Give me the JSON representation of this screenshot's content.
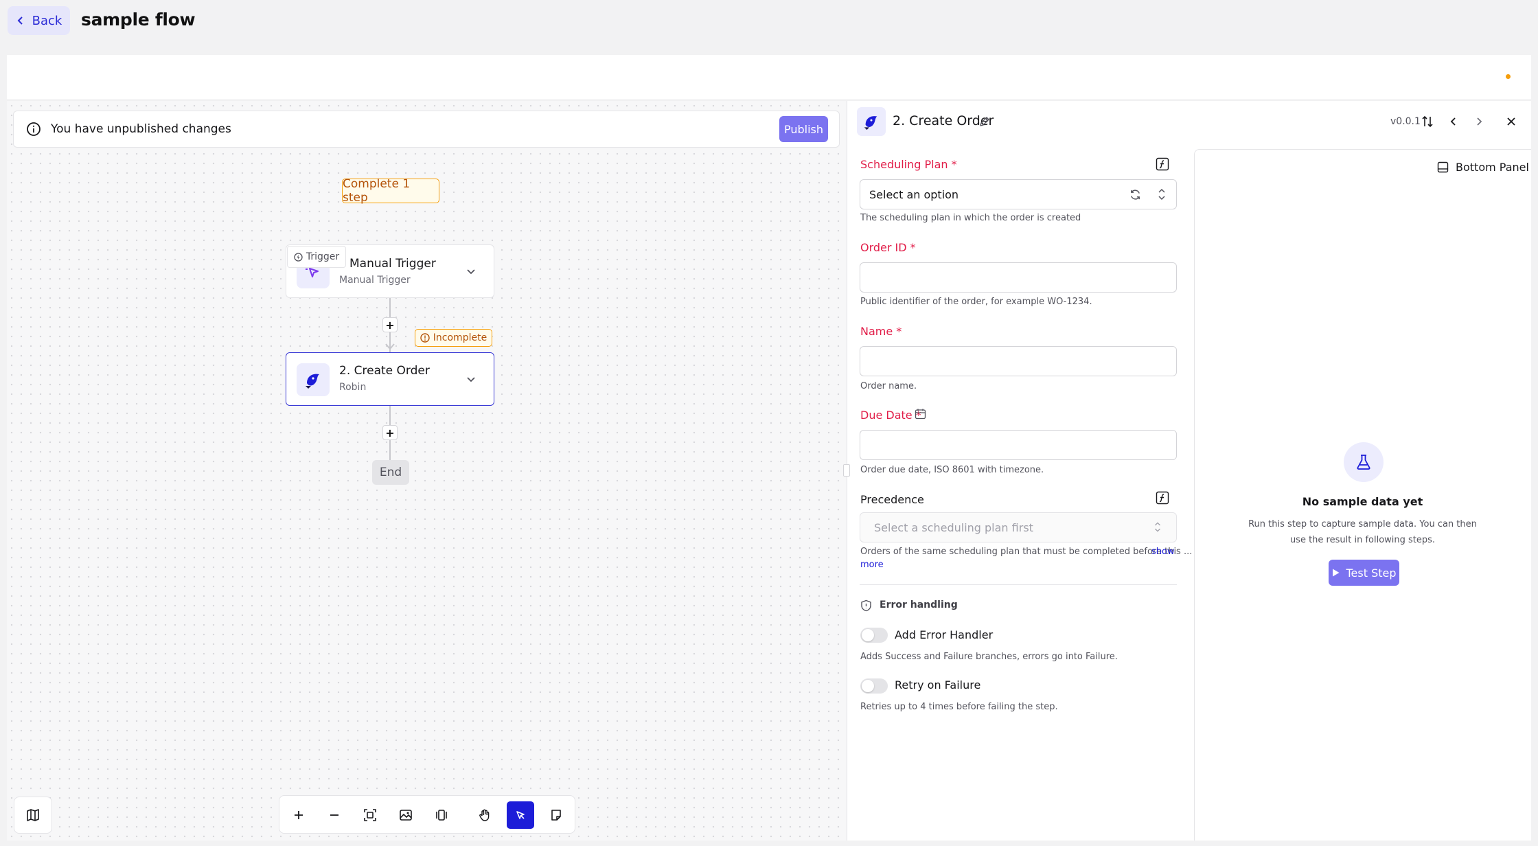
{
  "header": {
    "back_label": "Back",
    "flow_title": "sample flow"
  },
  "banner": {
    "message": "You have unpublished changes",
    "publish_label": "Publish"
  },
  "canvas": {
    "complete_badge": "Complete 1 step",
    "trigger_tag": "Trigger",
    "trigger_node": {
      "title": "Manual Trigger",
      "subtitle": "Manual Trigger"
    },
    "incomplete_badge": "Incomplete",
    "order_node": {
      "title": "2. Create Order",
      "subtitle": "Robin"
    },
    "end_label": "End",
    "plus_label": "+"
  },
  "panel": {
    "step_title": "2. Create Order",
    "version": "v0.0.1",
    "fields": {
      "scheduling_plan": {
        "label": "Scheduling Plan *",
        "placeholder": "Select an option",
        "help": "The scheduling plan in which the order is created"
      },
      "order_id": {
        "label": "Order ID *",
        "help": "Public identifier of the order, for example WO-1234."
      },
      "name": {
        "label": "Name *",
        "help": "Order name."
      },
      "due_date": {
        "label": "Due Date *",
        "help": "Order due date, ISO 8601 with timezone."
      },
      "precedence": {
        "label": "Precedence",
        "placeholder": "Select a scheduling plan first",
        "help": "Orders of the same scheduling plan that must be completed before this ...",
        "show": "show",
        "more": "more"
      }
    },
    "error_handling": {
      "title": "Error handling",
      "add_handler": {
        "label": "Add Error Handler",
        "help": "Adds Success and Failure branches, errors go into Failure."
      },
      "retry": {
        "label": "Retry on Failure",
        "help": "Retries up to 4 times before failing the step."
      }
    }
  },
  "sample": {
    "bottom_panel_label": "Bottom Panel",
    "title": "No sample data yet",
    "description": "Run this step to capture sample data. You can then use the result in following steps.",
    "test_label": "Test Step"
  },
  "colors": {
    "accent": "#1d1dd8",
    "publish": "#7b73f0",
    "warning": "#f59e0b",
    "required": "#e11d48"
  }
}
